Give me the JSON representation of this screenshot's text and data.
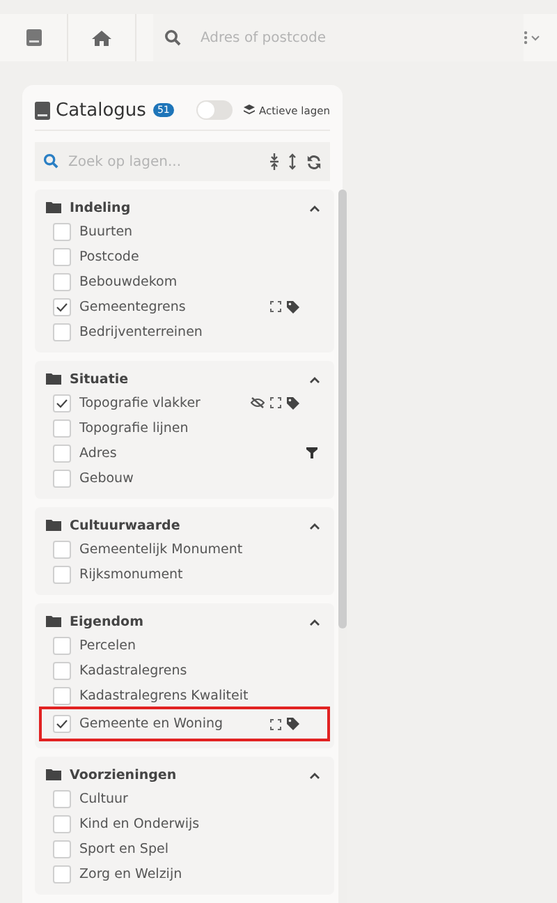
{
  "toolbar": {
    "search_placeholder": "Adres of postcode"
  },
  "catalogue": {
    "title": "Catalogus",
    "count": "51",
    "active_layers_toggle": {
      "on": false,
      "label": "Actieve lagen"
    },
    "search_placeholder": "Zoek op lagen..."
  },
  "groups": [
    {
      "title": "Indeling",
      "expanded": true,
      "layers": [
        {
          "label": "Buurten",
          "checked": false,
          "highlighted": false
        },
        {
          "label": "Postcode",
          "checked": false,
          "highlighted": false
        },
        {
          "label": "Bebouwdekom",
          "checked": false,
          "highlighted": false
        },
        {
          "label": "Gemeentegrens",
          "checked": true,
          "highlighted": false,
          "tools": [
            {
              "kind": "extent"
            },
            {
              "kind": "legend"
            }
          ]
        },
        {
          "label": "Bedrijventerreinen",
          "checked": false,
          "highlighted": false
        }
      ]
    },
    {
      "title": "Situatie",
      "expanded": true,
      "layers": [
        {
          "label": "Topografie vlakker",
          "checked": true,
          "highlighted": false,
          "tools": [
            {
              "kind": "hidden"
            },
            {
              "kind": "extent"
            },
            {
              "kind": "legend"
            }
          ]
        },
        {
          "label": "Topografie lijnen",
          "checked": false,
          "highlighted": false
        },
        {
          "label": "Adres",
          "checked": false,
          "highlighted": false,
          "tools": [
            {
              "kind": "filter"
            }
          ]
        },
        {
          "label": "Gebouw",
          "checked": false,
          "highlighted": false
        }
      ]
    },
    {
      "title": "Cultuurwaarde",
      "expanded": true,
      "layers": [
        {
          "label": "Gemeentelijk Monument",
          "checked": false,
          "highlighted": false
        },
        {
          "label": "Rijksmonument",
          "checked": false,
          "highlighted": false
        }
      ]
    },
    {
      "title": "Eigendom",
      "expanded": true,
      "layers": [
        {
          "label": "Percelen",
          "checked": false,
          "highlighted": false
        },
        {
          "label": "Kadastralegrens",
          "checked": false,
          "highlighted": false
        },
        {
          "label": "Kadastralegrens Kwaliteit",
          "checked": false,
          "highlighted": false
        },
        {
          "label": "Gemeente en Woning",
          "checked": true,
          "highlighted": true,
          "tools": [
            {
              "kind": "extent"
            },
            {
              "kind": "legend"
            }
          ]
        }
      ]
    },
    {
      "title": "Voorzieningen",
      "expanded": true,
      "layers": [
        {
          "label": "Cultuur",
          "checked": false,
          "highlighted": false
        },
        {
          "label": "Kind en Onderwijs",
          "checked": false,
          "highlighted": false
        },
        {
          "label": "Sport en Spel",
          "checked": false,
          "highlighted": false
        },
        {
          "label": "Zorg en Welzijn",
          "checked": false,
          "highlighted": false
        }
      ]
    }
  ]
}
